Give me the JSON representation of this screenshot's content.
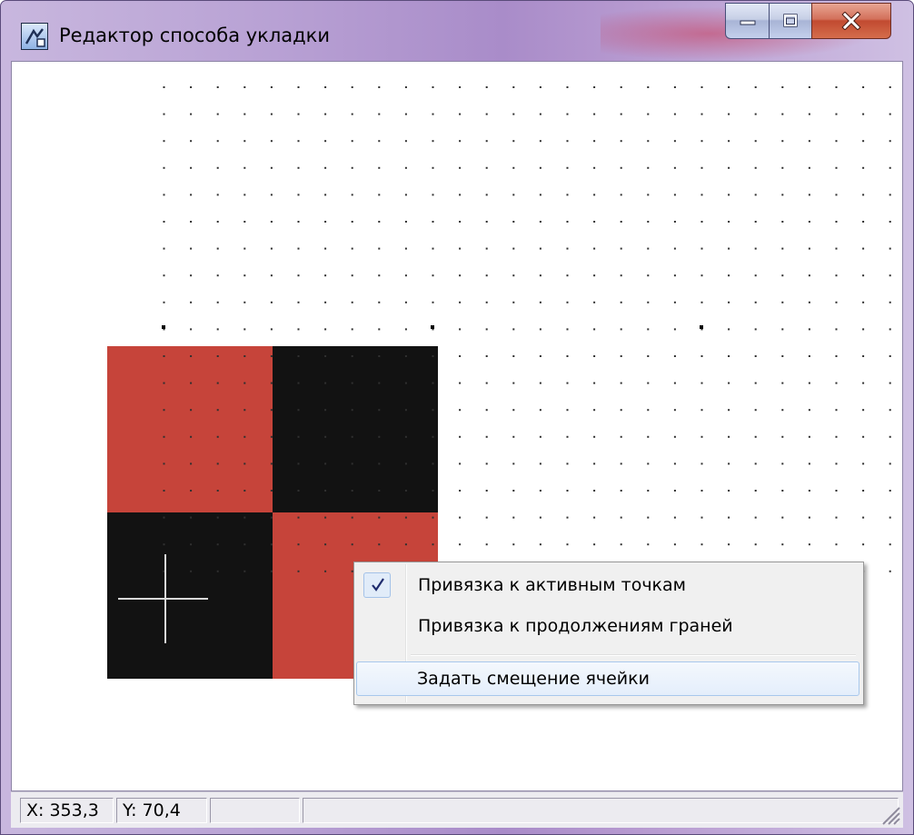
{
  "window": {
    "title": "Редактор способа укладки",
    "icon": "pattern-editor-icon"
  },
  "colors": {
    "tile_red": "#c6443a",
    "tile_black": "#121212",
    "grid_dot": "#303030",
    "crosshair": "#d8d8d8"
  },
  "context_menu": {
    "items": [
      {
        "label": "Привязка к активным точкам",
        "checked": true
      },
      {
        "label": "Привязка к продолжениям граней",
        "checked": false
      },
      {
        "label": "Задать смещение ячейки",
        "checked": false,
        "highlighted": true
      }
    ]
  },
  "status": {
    "x": "X: 353,3",
    "y": "Y: 70,4",
    "cell3": "",
    "cell4": ""
  }
}
